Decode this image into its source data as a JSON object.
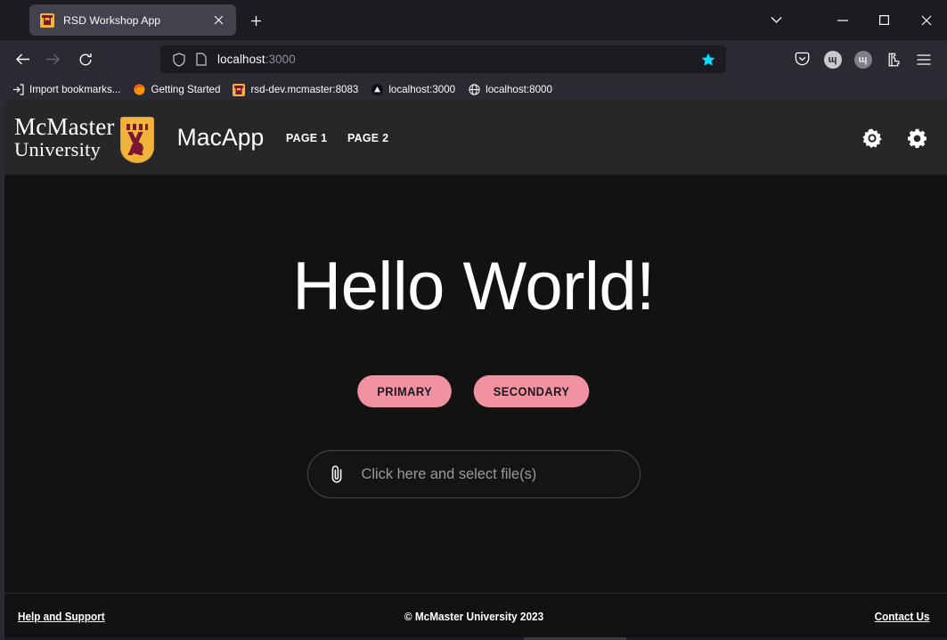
{
  "browser": {
    "tab": {
      "title": "RSD Workshop App",
      "favicon_name": "mcmaster-crest-favicon",
      "close_label": "✕"
    },
    "new_tab_label": "+",
    "window_controls": {
      "tab_list": "⌄",
      "minimize": "—",
      "maximize": "□",
      "close": "✕"
    },
    "nav": {
      "back": "back-arrow",
      "forward": "forward-arrow",
      "reload": "reload-icon"
    },
    "url": {
      "host": "localhost",
      "port": ":3000",
      "shield_icon": "shield-icon",
      "page_icon": "page-icon",
      "bookmark_star": "star-icon",
      "star_color": "#00ddff"
    },
    "toolbar_icons": [
      {
        "name": "pocket-icon",
        "glyph": ""
      },
      {
        "name": "account-avatar-icon",
        "glyph": "ɰ"
      },
      {
        "name": "container-avatar-icon",
        "glyph": "ɰ"
      },
      {
        "name": "extensions-icon",
        "glyph": ""
      },
      {
        "name": "app-menu-icon",
        "glyph": "☰"
      }
    ],
    "bookmarks": [
      {
        "label": "Import bookmarks...",
        "icon": "import-icon"
      },
      {
        "label": "Getting Started",
        "icon": "firefox-icon"
      },
      {
        "label": "rsd-dev.mcmaster:8083",
        "icon": "mcmaster-crest-icon"
      },
      {
        "label": "localhost:3000",
        "icon": "triangle-icon"
      },
      {
        "label": "localhost:8000",
        "icon": "globe-icon"
      }
    ]
  },
  "app": {
    "logo": {
      "line1": "McMaster",
      "line2": "University",
      "crest_name": "mcmaster-crest",
      "crest_color": "#f2b33d",
      "crest_accent": "#7a1632"
    },
    "brand": "MacApp",
    "nav_links": [
      {
        "label": "PAGE 1"
      },
      {
        "label": "PAGE 2"
      }
    ],
    "header_icons": [
      {
        "name": "brightness-icon",
        "title": "Toggle light mode"
      },
      {
        "name": "gear-icon",
        "title": "Settings"
      }
    ],
    "header_bg": "#272727",
    "body_bg": "#121212"
  },
  "main": {
    "title": "Hello World!",
    "buttons": [
      {
        "label": "PRIMARY",
        "bg": "#f0929f",
        "fg": "#1a1a24"
      },
      {
        "label": "SECONDARY",
        "bg": "#f0929f",
        "fg": "#1a1a24"
      }
    ],
    "dropzone": {
      "placeholder": "Click here and select file(s)",
      "icon": "paperclip-icon"
    }
  },
  "footer": {
    "left_link": "Help and Support",
    "copyright": "© McMaster University 2023",
    "right_link": "Contact Us"
  }
}
